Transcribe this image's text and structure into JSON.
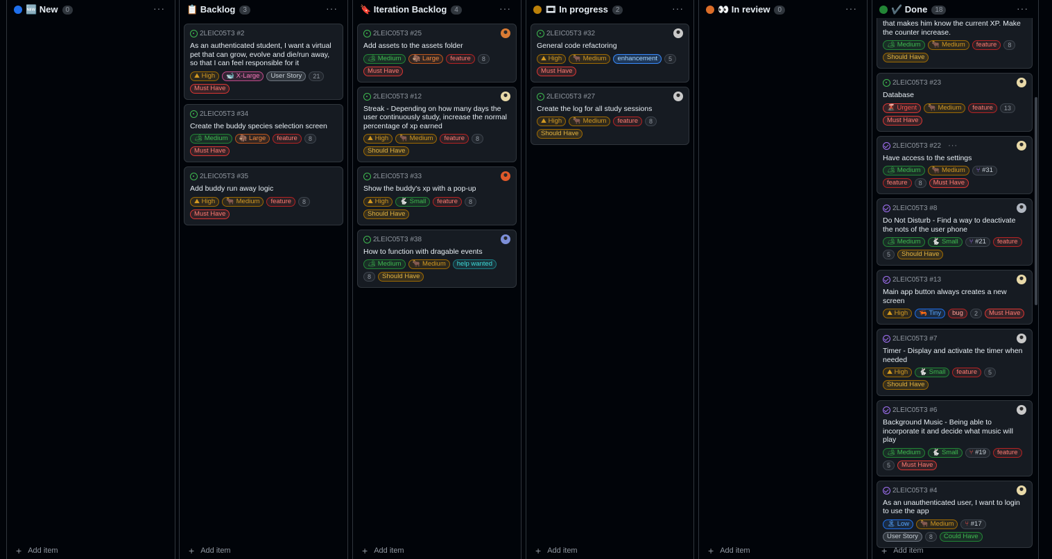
{
  "columns": [
    {
      "key": "new",
      "title": "🆕 New",
      "count": "0",
      "dot": "#1f6feb",
      "cards": []
    },
    {
      "key": "backlog",
      "title": "📋 Backlog",
      "count": "3",
      "dot": null,
      "cards": [
        {
          "id": "2LEIC05T3 #2",
          "title": "As an authenticated student, I want a virtual pet that can grow, evolve and die/run away, so that I can feel responsible for it",
          "labels": [
            [
              "high",
              "⛰ High"
            ],
            [
              "xlarge",
              "🐋 X-Large"
            ],
            [
              "story",
              "User Story"
            ],
            [
              "num",
              "21"
            ],
            [
              "must",
              "Must Have"
            ]
          ]
        },
        {
          "id": "2LEIC05T3 #34",
          "title": "Create the buddy species selection screen",
          "labels": [
            [
              "medium",
              "🏕 Medium"
            ],
            [
              "large",
              "🦣 Large"
            ],
            [
              "feature",
              "feature"
            ],
            [
              "num",
              "8"
            ],
            [
              "must",
              "Must Have"
            ]
          ]
        },
        {
          "id": "2LEIC05T3 #35",
          "title": "Add buddy run away logic",
          "labels": [
            [
              "high",
              "⛰ High"
            ],
            [
              "medsize",
              "🐂 Medium"
            ],
            [
              "feature",
              "feature"
            ],
            [
              "num",
              "8"
            ],
            [
              "must",
              "Must Have"
            ]
          ]
        }
      ]
    },
    {
      "key": "iter",
      "title": "🔖 Iteration Backlog",
      "count": "4",
      "dot": null,
      "cards": [
        {
          "id": "2LEIC05T3 #25",
          "title": "Add assets to the assets folder",
          "avatar": "#d97b34",
          "labels": [
            [
              "medium",
              "🏕 Medium"
            ],
            [
              "large",
              "🦣 Large"
            ],
            [
              "feature",
              "feature"
            ],
            [
              "num",
              "8"
            ],
            [
              "must",
              "Must Have"
            ]
          ]
        },
        {
          "id": "2LEIC05T3 #12",
          "title": "Streak - Depending on how many days the user continuously study, increase the normal percentage of xp earned",
          "avatar": "#e8d9a8",
          "labels": [
            [
              "high",
              "⛰ High"
            ],
            [
              "medsize",
              "🐂 Medium"
            ],
            [
              "feature",
              "feature"
            ],
            [
              "num",
              "8"
            ],
            [
              "should",
              "Should Have"
            ]
          ]
        },
        {
          "id": "2LEIC05T3 #33",
          "title": "Show the buddy's xp with a pop-up",
          "avatar": "#e0592a",
          "labels": [
            [
              "high",
              "⛰ High"
            ],
            [
              "small",
              "🐇 Small"
            ],
            [
              "feature",
              "feature"
            ],
            [
              "num",
              "8"
            ],
            [
              "should",
              "Should Have"
            ]
          ]
        },
        {
          "id": "2LEIC05T3 #38",
          "title": "How to function with dragable events",
          "avatar": "#7d8fd8",
          "labels": [
            [
              "medium",
              "🏕 Medium"
            ],
            [
              "medsize",
              "🐂 Medium"
            ],
            [
              "help",
              "help wanted"
            ],
            [
              "num",
              "8"
            ],
            [
              "should",
              "Should Have"
            ]
          ]
        }
      ]
    },
    {
      "key": "progress",
      "title": "🎞 In progress",
      "count": "2",
      "dot": "#bb8009",
      "cards": [
        {
          "id": "2LEIC05T3 #32",
          "title": "General code refactoring",
          "avatar": "#c9c9c9",
          "labels": [
            [
              "high",
              "⛰ High"
            ],
            [
              "medsize",
              "🐂 Medium"
            ],
            [
              "enh",
              "enhancement"
            ],
            [
              "num",
              "5"
            ],
            [
              "must",
              "Must Have"
            ]
          ]
        },
        {
          "id": "2LEIC05T3 #27",
          "title": "Create the log for all study sessions",
          "avatar": "#c9c9c9",
          "labels": [
            [
              "high",
              "⛰ High"
            ],
            [
              "medsize",
              "🐂 Medium"
            ],
            [
              "feature",
              "feature"
            ],
            [
              "num",
              "8"
            ],
            [
              "should",
              "Should Have"
            ]
          ]
        }
      ]
    },
    {
      "key": "review",
      "title": "👀 In review",
      "count": "0",
      "dot": "#db6d28",
      "cards": []
    },
    {
      "key": "done",
      "title": "✔️ Done",
      "count": "18",
      "dot": "#238636",
      "cards": [
        {
          "id": "",
          "title": "that makes him know the current XP. Make the counter increase.",
          "labels": [
            [
              "medium",
              "🏕 Medium"
            ],
            [
              "medsize",
              "🐂 Medium"
            ],
            [
              "feature",
              "feature"
            ],
            [
              "num",
              "8"
            ],
            [
              "should",
              "Should Have"
            ]
          ]
        },
        {
          "id": "2LEIC05T3 #23",
          "title": "Database",
          "avatar": "#e8d9a8",
          "labels": [
            [
              "urgent",
              "🌋 Urgent"
            ],
            [
              "medsize",
              "🐂 Medium"
            ],
            [
              "feature",
              "feature"
            ],
            [
              "num",
              "13"
            ],
            [
              "must",
              "Must Have"
            ]
          ]
        },
        {
          "id": "2LEIC05T3 #22",
          "title": "Have access to the settings",
          "avatar": "#e8d9a8",
          "dots": true,
          "done": true,
          "labels": [
            [
              "medium",
              "🏕 Medium"
            ],
            [
              "medsize",
              "🐂 Medium"
            ],
            [
              "pr",
              "#31"
            ],
            [
              "feature",
              "feature"
            ],
            [
              "num",
              "8"
            ],
            [
              "must",
              "Must Have"
            ]
          ]
        },
        {
          "id": "2LEIC05T3 #8",
          "title": "Do Not Disturb - Find a way to deactivate the nots of the user phone",
          "avatar": "#b0b6c0",
          "done": true,
          "labels": [
            [
              "medium",
              "🏕 Medium"
            ],
            [
              "small",
              "🐇 Small"
            ],
            [
              "pr",
              "#21"
            ],
            [
              "feature",
              "feature"
            ],
            [
              "num",
              "5"
            ],
            [
              "should",
              "Should Have"
            ]
          ]
        },
        {
          "id": "2LEIC05T3 #13",
          "title": "Main app button always creates a new screen",
          "avatar": "#e8d9a8",
          "done": true,
          "labels": [
            [
              "high",
              "⛰ High"
            ],
            [
              "tiny",
              "🦐 Tiny"
            ],
            [
              "bug",
              "bug"
            ],
            [
              "num",
              "2"
            ],
            [
              "must",
              "Must Have"
            ]
          ]
        },
        {
          "id": "2LEIC05T3 #7",
          "title": "Timer - Display and activate the timer when needed",
          "avatar": "#c9c9c9",
          "done": true,
          "labels": [
            [
              "high",
              "⛰ High"
            ],
            [
              "small",
              "🐇 Small"
            ],
            [
              "feature",
              "feature"
            ],
            [
              "num",
              "5"
            ],
            [
              "should",
              "Should Have"
            ]
          ]
        },
        {
          "id": "2LEIC05T3 #6",
          "title": "Background Music - Being able to incorporate it and decide what music will play",
          "avatar": "#c9c9c9",
          "done": true,
          "labels": [
            [
              "medium",
              "🏕 Medium"
            ],
            [
              "small",
              "🐇 Small"
            ],
            [
              "prred",
              "#19"
            ],
            [
              "feature",
              "feature"
            ],
            [
              "num",
              "5"
            ],
            [
              "must",
              "Must Have"
            ]
          ]
        },
        {
          "id": "2LEIC05T3 #4",
          "title": "As an unauthenticated user, I want to login to use the app",
          "avatar": "#e8d9a8",
          "done": true,
          "labels": [
            [
              "low",
              "🏝 Low"
            ],
            [
              "medsize",
              "🐂 Medium"
            ],
            [
              "prred",
              "#17"
            ],
            [
              "story",
              "User Story"
            ],
            [
              "num",
              "8"
            ],
            [
              "could",
              "Could Have"
            ]
          ]
        }
      ]
    }
  ],
  "add_item": "Add item",
  "more": "···"
}
